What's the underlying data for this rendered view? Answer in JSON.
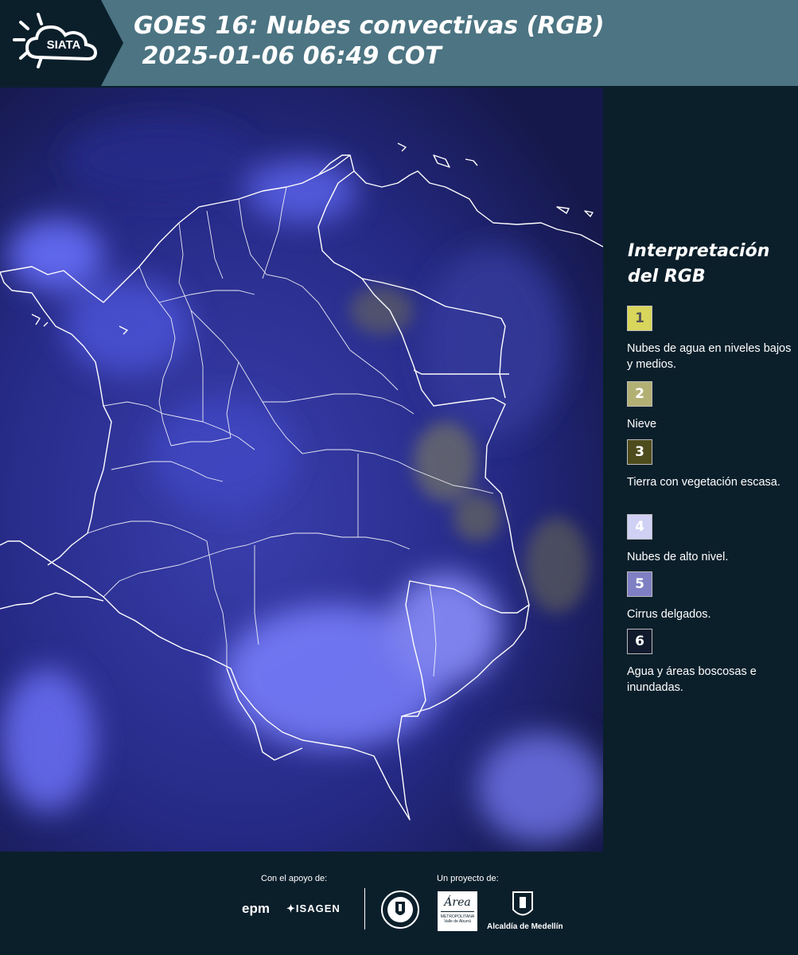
{
  "header": {
    "logo_text": "SIATA",
    "title_line1": "GOES 16: Nubes convectivas (RGB)",
    "title_line2": " 2025-01-06 06:49 COT",
    "background_color": "#4c7482"
  },
  "map": {
    "ocean_color": "#1a1d58",
    "cloud_color": "#5b63e0",
    "border_color": "#ffffff"
  },
  "legend": {
    "title": "Interpretación del RGB",
    "items": [
      {
        "number": "1",
        "label": "Nubes de agua en niveles bajos y medios.",
        "color": "#d9d65c"
      },
      {
        "number": "2",
        "label": "Nieve",
        "color": "#b3b074"
      },
      {
        "number": "3",
        "label": "Tierra con vegetación escasa.",
        "color": "#4e4c1d"
      },
      {
        "number": "4",
        "label": "Nubes de alto nivel.",
        "color": "#cfd0f4"
      },
      {
        "number": "5",
        "label": "Cirrus delgados.",
        "color": "#7f7fc4"
      },
      {
        "number": "6",
        "label": "Agua y áreas boscosas e inundadas.",
        "color": "#101a2c"
      }
    ]
  },
  "footer": {
    "support_label": "Con el apoyo de:",
    "project_label": "Un proyecto de:",
    "sponsors": {
      "epm": "epm",
      "isagen": "ISAGEN",
      "metropolitana": "METROPOLITANA",
      "valle": "Valle de Aburrá",
      "alcaldia": "Alcaldía de Medellín"
    },
    "area_logo_text": "Área"
  }
}
